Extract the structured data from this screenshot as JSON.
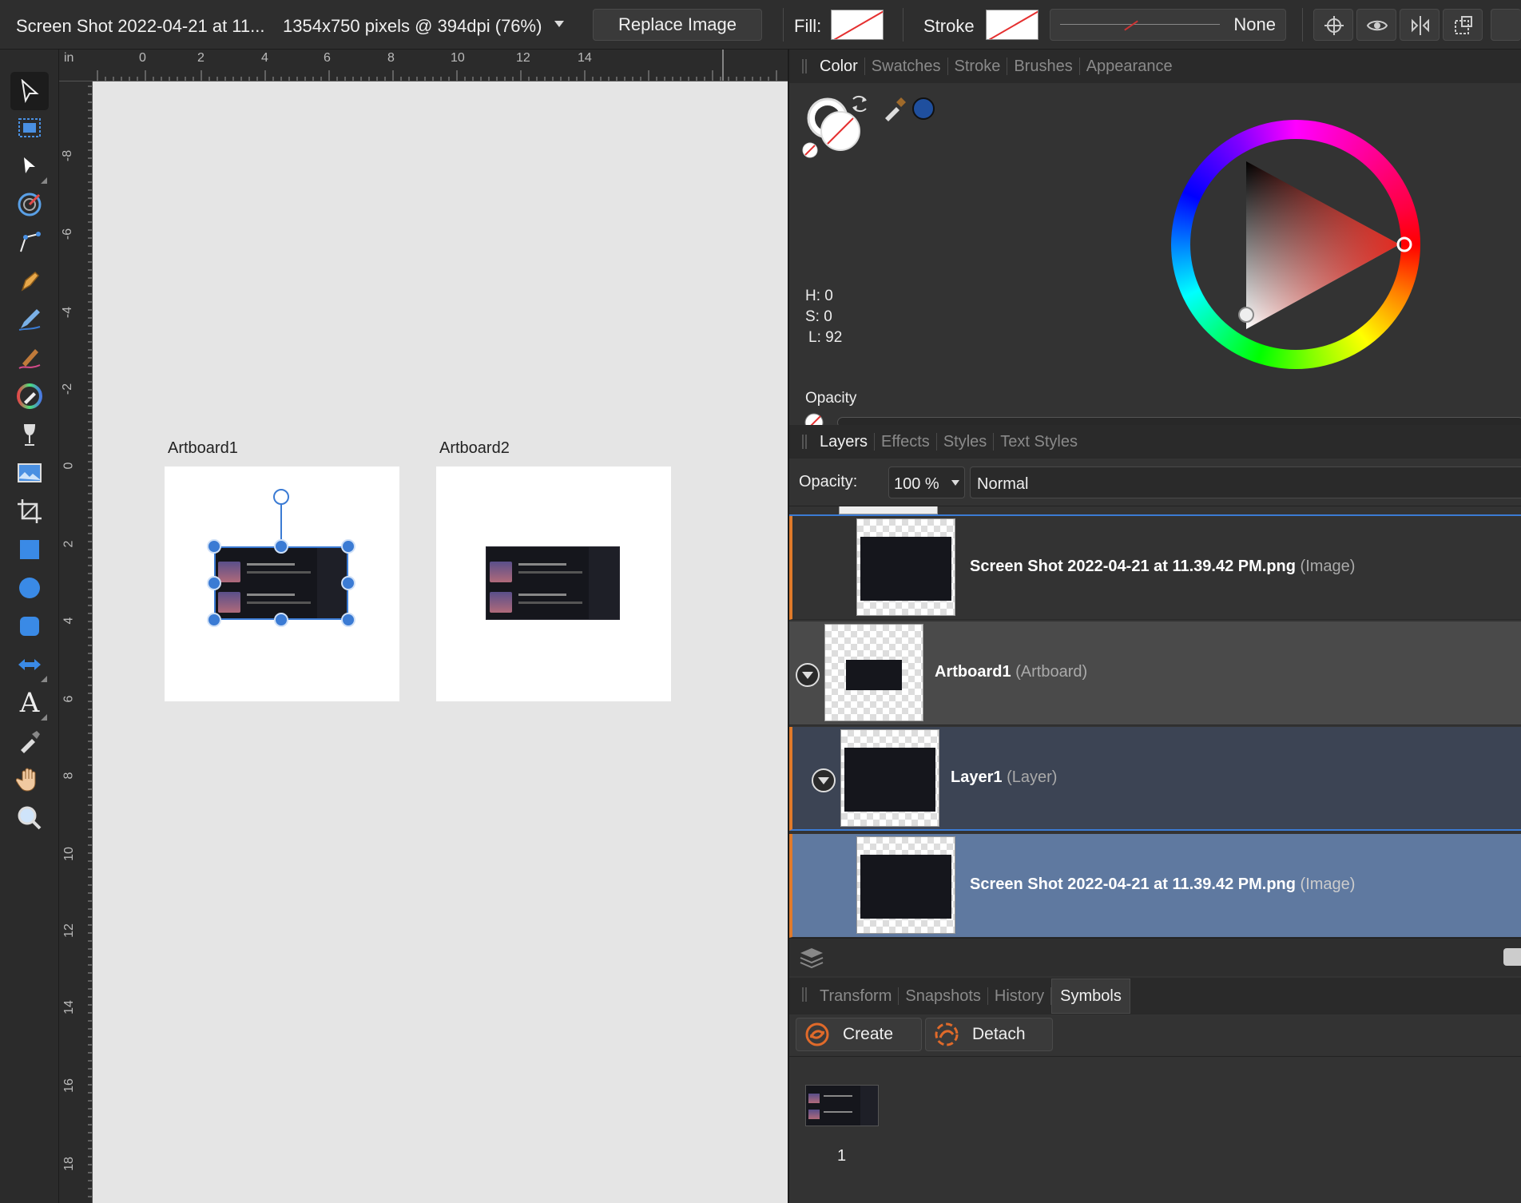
{
  "context_toolbar": {
    "document_title": "Screen Shot 2022-04-21 at 11...",
    "image_info": "1354x750 pixels @ 394dpi (76%)",
    "replace_image_label": "Replace Image",
    "fill_label": "Fill:",
    "stroke_label": "Stroke",
    "stroke_width_value": "None"
  },
  "ruler": {
    "unit": "in",
    "top_numbers": [
      "0",
      "2",
      "4",
      "6",
      "8",
      "10",
      "12",
      "14"
    ],
    "left_numbers": [
      "-8",
      "-6",
      "-4",
      "-2",
      "0",
      "2",
      "4",
      "6",
      "8",
      "10",
      "12",
      "14",
      "16",
      "18"
    ]
  },
  "canvas": {
    "artboards": [
      {
        "label": "Artboard1"
      },
      {
        "label": "Artboard2"
      }
    ]
  },
  "color_panel": {
    "tabs": [
      "Color",
      "Swatches",
      "Stroke",
      "Brushes",
      "Appearance"
    ],
    "active_tab": "Color",
    "h": "H: 0",
    "s": "S: 0",
    "l": "L: 92",
    "opacity_label": "Opacity",
    "selected_color": "#1f4f9e"
  },
  "layers_panel": {
    "tabs": [
      "Layers",
      "Effects",
      "Styles",
      "Text Styles"
    ],
    "active_tab": "Layers",
    "opacity_label": "Opacity:",
    "opacity_value": "100 %",
    "blend_mode": "Normal",
    "rows": [
      {
        "name": "Screen Shot 2022-04-21 at 11.39.42 PM.png",
        "type": "(Image)"
      },
      {
        "name": "Artboard1",
        "type": "(Artboard)"
      },
      {
        "name": "Layer1",
        "type": "(Layer)"
      },
      {
        "name": "Screen Shot 2022-04-21 at 11.39.42 PM.png",
        "type": "(Image)"
      }
    ]
  },
  "bottom_panel": {
    "tabs": [
      "Transform",
      "Snapshots",
      "History",
      "Symbols"
    ],
    "active_tab": "Symbols",
    "create_label": "Create",
    "detach_label": "Detach",
    "symbol_count": "1"
  }
}
